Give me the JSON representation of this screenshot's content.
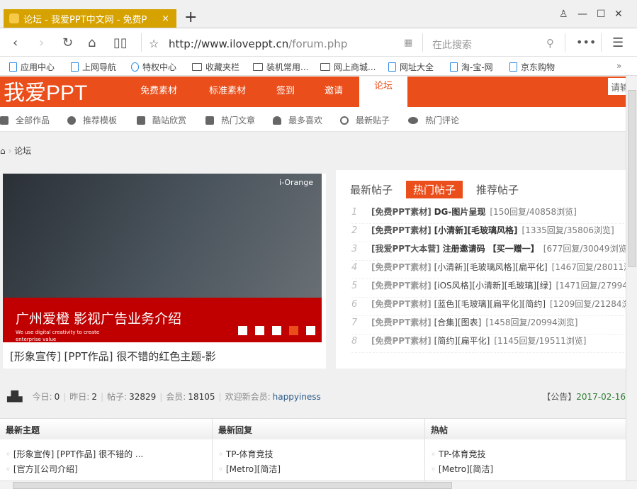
{
  "browser": {
    "tab_title": "论坛 - 我爱PPT中文网 - 免费P",
    "url_host": "http://www.iloveppt.cn",
    "url_path": "/forum.php",
    "search_placeholder": "在此搜索",
    "bookmarks": [
      "应用中心",
      "上网导航",
      "特权中心",
      "收藏夹栏",
      "装机常用...",
      "网上商城...",
      "网址大全",
      "淘-宝-网",
      "京东购物"
    ]
  },
  "site": {
    "logo": "我爱PPT",
    "nav": [
      "免费素材",
      "标准素材",
      "签到",
      "邀请"
    ],
    "nav_active": "论坛",
    "search_placeholder": "请输",
    "subnav": [
      "全部作品",
      "推荐模板",
      "酷站欣赏",
      "热门文章",
      "最多喜欢",
      "最新贴子",
      "热门评论"
    ],
    "breadcrumb": "论坛"
  },
  "slider": {
    "title": "广州爱橙 影视广告业务介绍",
    "subtitle": "We use digital creativity to create enterprise value",
    "brand": "i-Orange",
    "caption": "[形象宣传] [PPT作品] 很不错的红色主题-影",
    "active_dot": 4,
    "dots": 5
  },
  "hot": {
    "tabs": [
      "最新帖子",
      "热门帖子",
      "推荐帖子"
    ],
    "active_tab": 1,
    "rows": [
      {
        "n": "1",
        "cat": "[免费PPT素材]",
        "title": "DG-图片呈现",
        "meta": "[150回复/40858浏览]",
        "bold": true
      },
      {
        "n": "2",
        "cat": "[免费PPT素材]",
        "title": "[小清新][毛玻璃风格]",
        "meta": "[1335回复/35806浏览]",
        "bold": true
      },
      {
        "n": "3",
        "cat": "[我爱PPT大本营]",
        "title": "注册邀请码 【买一赠一】",
        "meta": "[677回复/30049浏览]",
        "bold": true
      },
      {
        "n": "4",
        "cat": "[免费PPT素材]",
        "title": "[小清新][毛玻璃风格][扁平化]",
        "meta": "[1467回复/28011浏"
      },
      {
        "n": "5",
        "cat": "[免费PPT素材]",
        "title": "[iOS风格][小清新][毛玻璃][绿]",
        "meta": "[1471回复/27994"
      },
      {
        "n": "6",
        "cat": "[免费PPT素材]",
        "title": "[蓝色][毛玻璃][扁平化][简约]",
        "meta": "[1209回复/21284浏"
      },
      {
        "n": "7",
        "cat": "[免费PPT素材]",
        "title": "[合集][图表]",
        "meta": "[1458回复/20994浏览]"
      },
      {
        "n": "8",
        "cat": "[免费PPT素材]",
        "title": "[简约][扁平化]",
        "meta": "[1145回复/19511浏览]"
      }
    ]
  },
  "stats": {
    "today_label": "今日:",
    "today": "0",
    "yesterday_label": "昨日:",
    "yesterday": "2",
    "posts_label": "帖子:",
    "posts": "32829",
    "members_label": "会员:",
    "members": "18105",
    "welcome_label": "欢迎新会员:",
    "welcome": "happyiness",
    "notice_label": "【公告】",
    "notice": "2017-02-16"
  },
  "columns": [
    {
      "title": "最新主题",
      "items": [
        "[形象宣传] [PPT作品] 很不错的 ...",
        "[官方][公司介绍]"
      ]
    },
    {
      "title": "最新回复",
      "items": [
        "TP-体育竞技",
        "[Metro][简洁]"
      ]
    },
    {
      "title": "热帖",
      "items": [
        "TP-体育竞技",
        "[Metro][简洁]"
      ]
    }
  ],
  "colors": {
    "brand": "#e94e1b",
    "tab": "#d6a200",
    "slide_red": "#c00000"
  }
}
